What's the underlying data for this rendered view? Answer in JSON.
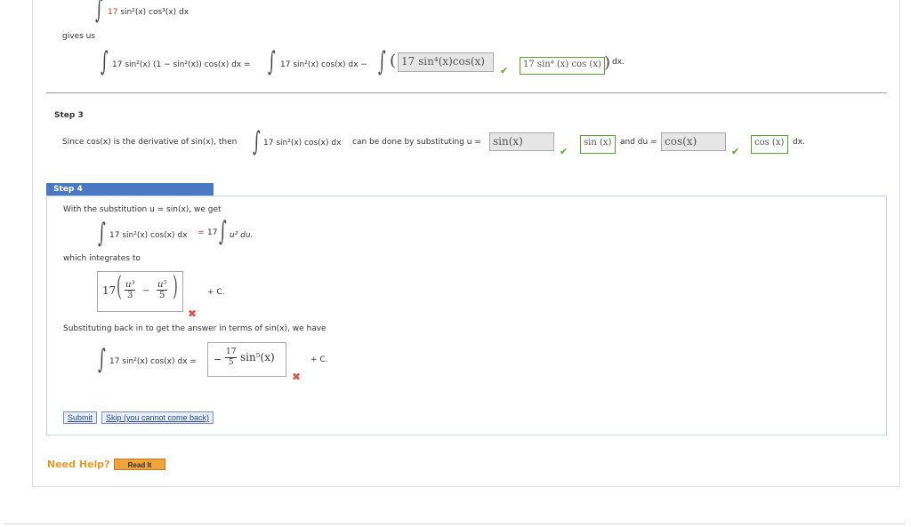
{
  "top": {
    "integrand_coeff": "17",
    "integrand_rest": " sin²(x) cos³(x) dx",
    "gives_us": "gives us"
  },
  "eq1": {
    "term_a": "17 sin²(x) (1 − sin²(x)) cos(x) dx =",
    "term_b": "17 sin²(x) cos(x) dx −",
    "answer_entered": "17 sin⁴(x)cos(x)",
    "answer_correct": "17 sin⁴ (x) cos (x)",
    "tail": "dx."
  },
  "step3": {
    "label": "Step 3",
    "text_a": "Since cos(x) is the derivative of sin(x), then",
    "integral": "17 sin²(x) cos(x) dx",
    "text_b": "can be done by substituting u =",
    "u_entered": "sin(x)",
    "u_correct": "sin (x)",
    "and_du": "and du =",
    "du_entered": "cos(x)",
    "du_correct": "cos (x)",
    "tail": "dx."
  },
  "step4": {
    "label": "Step 4",
    "line1": "With the substitution u = sin(x), we get",
    "integral_left": "17 sin²(x) cos(x) dx",
    "eq": "=",
    "coeff": "17",
    "integral_right": "u² du.",
    "which": "which integrates to",
    "ans_coeff": "17",
    "ans_n1": "u³",
    "ans_d1": "3",
    "ans_minus": "−",
    "ans_n2": "u⁵",
    "ans_d2": "5",
    "plus_c": "+ C.",
    "subst_text": "Substituting back in to get the answer in terms of sin(x), we have",
    "final_left": "17 sin²(x) cos(x) dx =",
    "final_neg": "−",
    "final_n": "17",
    "final_d": "5",
    "final_sin": "sin⁵(x)",
    "plus_c2": "+ C.",
    "submit": "Submit",
    "skip": "Skip (you cannot come back)"
  },
  "help": {
    "need_help": "Need Help?",
    "read_it": "Read It"
  },
  "colors": {
    "correct": "#5aa02c",
    "incorrect": "#d9534f",
    "step_bar": "#4a78c2",
    "help": "#e69a2c"
  }
}
